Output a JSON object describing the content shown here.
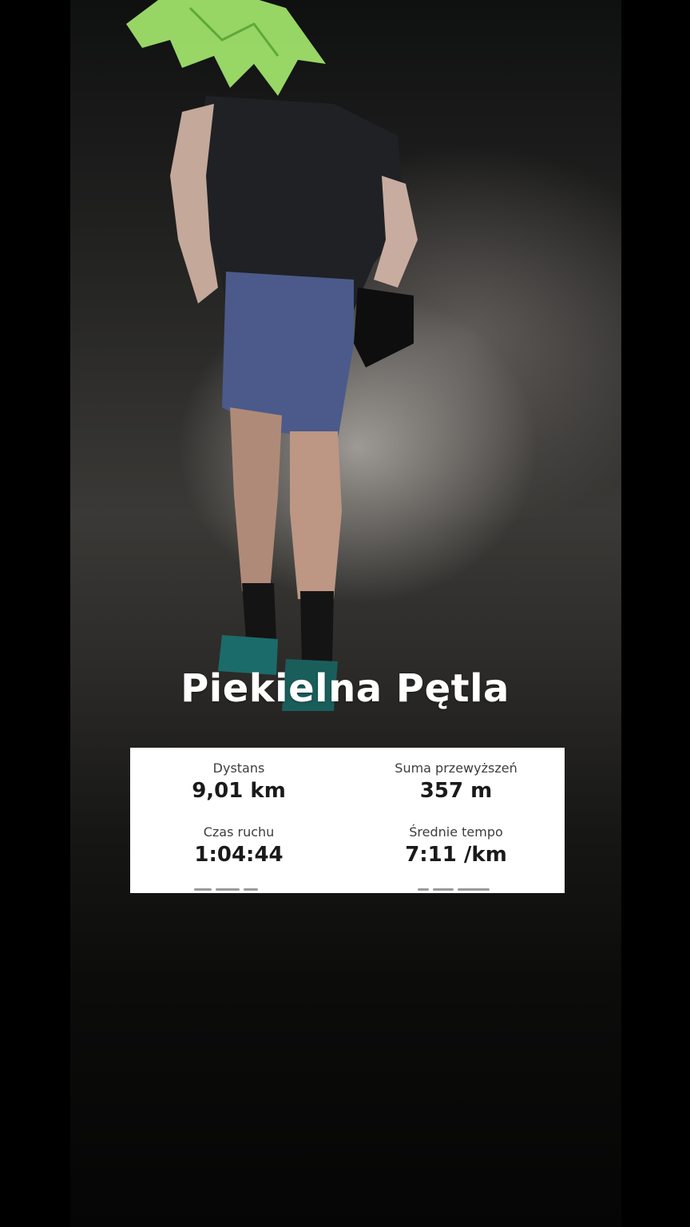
{
  "activity": {
    "title": "Piekielna Pętla"
  },
  "stats": [
    {
      "label": "Dystans",
      "value": "9,01 km"
    },
    {
      "label": "Suma przewyższeń",
      "value": "357 m"
    },
    {
      "label": "Czas ruchu",
      "value": "1:04:44"
    },
    {
      "label": "Średnie tempo",
      "value": "7:11 /km"
    }
  ]
}
